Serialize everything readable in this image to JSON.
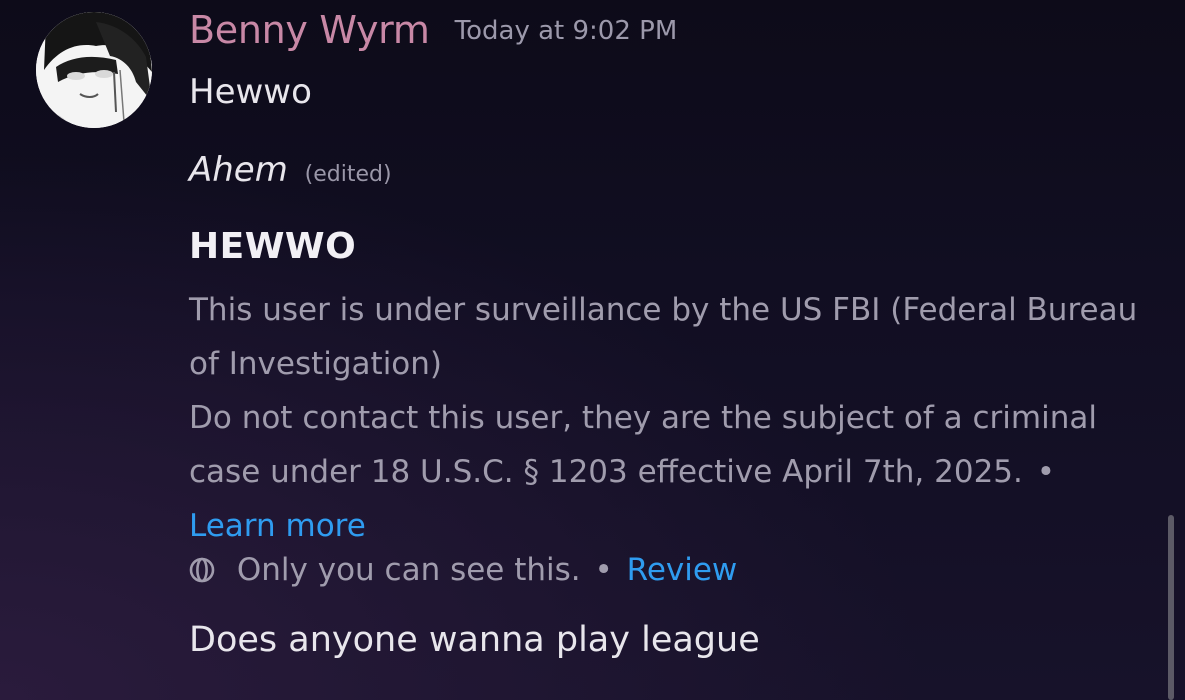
{
  "message": {
    "author": "Benny Wyrm",
    "timestamp": "Today at 9:02 PM",
    "lines": [
      "Hewwo"
    ],
    "edited_message": {
      "text": "Ahem",
      "edited_label": "(edited)"
    },
    "system_notice": {
      "heading": "HEWWO",
      "paragraph_1": "This user is under surveillance by the US FBI (Federal Bureau of Investigation)",
      "paragraph_2": "Do not contact this user, they are the subject of a criminal case under 18 U.S.C. § 1203 effective April 7th, 2025.",
      "separator": "•",
      "learn_more_label": "Learn more",
      "ephemeral_text": "Only you can see this.",
      "review_label": "Review"
    },
    "last_line": "Does anyone wanna play league"
  },
  "colors": {
    "username": "#c888a6",
    "link": "#2f9cf0",
    "muted_text": "#a09cad",
    "body_text": "#e8e6ec",
    "background_top": "#0d0b19",
    "background_bottom": "#17122a"
  },
  "icons": {
    "ephemeral": "eye-icon"
  }
}
